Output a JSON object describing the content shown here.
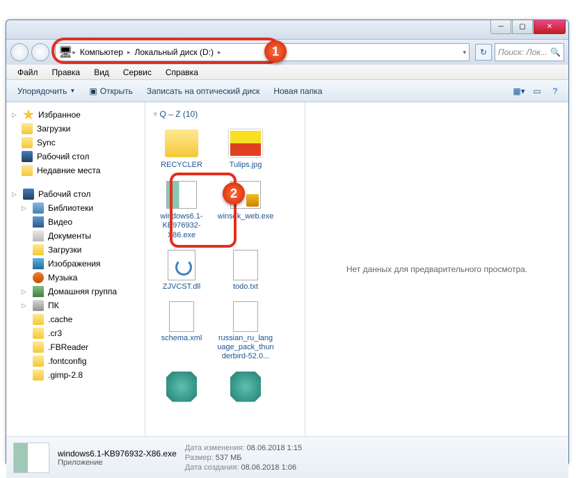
{
  "breadcrumb": {
    "root_icon": "computer-icon",
    "part1": "Компьютер",
    "part2": "Локальный диск (D:)"
  },
  "search": {
    "placeholder": "Поиск: Лок..."
  },
  "menu": {
    "file": "Файл",
    "edit": "Правка",
    "view": "Вид",
    "tools": "Сервис",
    "help": "Справка"
  },
  "toolbar": {
    "organize": "Упорядочить",
    "open": "Открыть",
    "burn": "Записать на оптический диск",
    "newfolder": "Новая папка"
  },
  "sidebar": {
    "favorites": {
      "head": "Избранное",
      "items": [
        "Загрузки",
        "Sync",
        "Рабочий стол",
        "Недавние места"
      ]
    },
    "desktop": {
      "head": "Рабочий стол"
    },
    "libraries": {
      "head": "Библиотеки",
      "items": [
        "Видео",
        "Документы",
        "Загрузки",
        "Изображения",
        "Музыка"
      ]
    },
    "homegroup": "Домашняя группа",
    "pc": {
      "head": "ПК",
      "items": [
        ".cache",
        ".cr3",
        ".FBReader",
        ".fontconfig",
        ".gimp-2.8"
      ]
    }
  },
  "group": {
    "label": "Q – Z (10)"
  },
  "files": [
    {
      "name": "RECYCLER",
      "thumb": "th-folder"
    },
    {
      "name": "Tulips.jpg",
      "thumb": "th-img"
    },
    {
      "name": "windows6.1-KB976932-X86.exe",
      "thumb": "th-exe"
    },
    {
      "name": "winsdk_web.exe",
      "thumb": "th-exe2"
    },
    {
      "name": "ZJVCST.dll",
      "thumb": "th-dll"
    },
    {
      "name": "todo.txt",
      "thumb": "th-txt"
    },
    {
      "name": "schema.xml",
      "thumb": "th-xml"
    },
    {
      "name": "russian_ru_language_pack_thunderbird-52.0...",
      "thumb": "th-txt"
    },
    {
      "name": "",
      "thumb": "th-reg"
    },
    {
      "name": "",
      "thumb": "th-reg"
    }
  ],
  "preview": {
    "empty": "Нет данных для предварительного просмотра."
  },
  "status": {
    "filename": "windows6.1-KB976932-X86.exe",
    "filetype": "Приложение",
    "modified_label": "Дата изменения:",
    "modified": "08.06.2018 1:15",
    "size_label": "Размер:",
    "size": "537 МБ",
    "created_label": "Дата создания:",
    "created": "08.06.2018 1:06"
  },
  "callouts": {
    "b1": "1",
    "b2": "2"
  }
}
